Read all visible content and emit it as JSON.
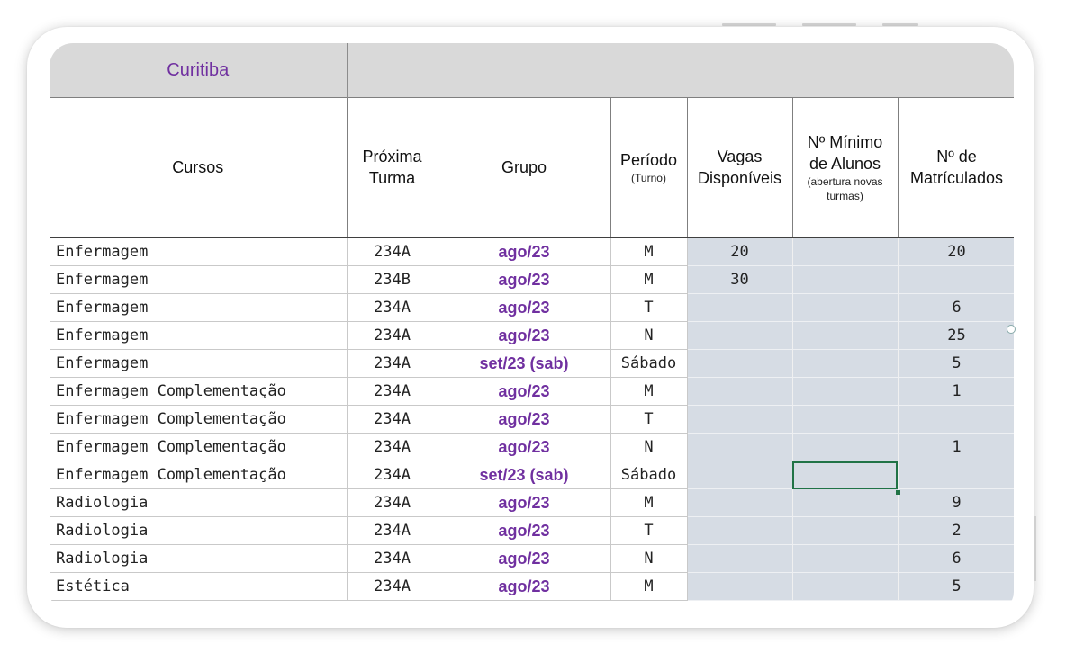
{
  "sheet": {
    "city": "Curitiba",
    "headers": {
      "cursos": "Cursos",
      "proxima_line1": "Próxima",
      "proxima_line2": "Turma",
      "grupo": "Grupo",
      "periodo": "Período",
      "periodo_sub": "(Turno)",
      "vagas_line1": "Vagas",
      "vagas_line2": "Disponíveis",
      "minimo_line1": "Nº Mínimo",
      "minimo_line2": "de Alunos",
      "minimo_sub": "(abertura novas turmas)",
      "matric_line1": "Nº de",
      "matric_line2": "Matrículados"
    },
    "rows": [
      {
        "curso": "Enfermagem",
        "turma": "234A",
        "grupo": "ago/23",
        "periodo": "M",
        "vagas": "20",
        "minimo": "",
        "matriculados": "20"
      },
      {
        "curso": "Enfermagem",
        "turma": "234B",
        "grupo": "ago/23",
        "periodo": "M",
        "vagas": "30",
        "minimo": "",
        "matriculados": ""
      },
      {
        "curso": "Enfermagem",
        "turma": "234A",
        "grupo": "ago/23",
        "periodo": "T",
        "vagas": "",
        "minimo": "",
        "matriculados": "6"
      },
      {
        "curso": "Enfermagem",
        "turma": "234A",
        "grupo": "ago/23",
        "periodo": "N",
        "vagas": "",
        "minimo": "",
        "matriculados": "25"
      },
      {
        "curso": "Enfermagem",
        "turma": "234A",
        "grupo": "set/23 (sab)",
        "periodo": "Sábado",
        "vagas": "",
        "minimo": "",
        "matriculados": "5"
      },
      {
        "curso": "Enfermagem Complementação",
        "turma": "234A",
        "grupo": "ago/23",
        "periodo": "M",
        "vagas": "",
        "minimo": "",
        "matriculados": "1"
      },
      {
        "curso": "Enfermagem Complementação",
        "turma": "234A",
        "grupo": "ago/23",
        "periodo": "T",
        "vagas": "",
        "minimo": "",
        "matriculados": ""
      },
      {
        "curso": "Enfermagem Complementação",
        "turma": "234A",
        "grupo": "ago/23",
        "periodo": "N",
        "vagas": "",
        "minimo": "",
        "matriculados": "1"
      },
      {
        "curso": "Enfermagem Complementação",
        "turma": "234A",
        "grupo": "set/23 (sab)",
        "periodo": "Sábado",
        "vagas": "",
        "minimo": "",
        "matriculados": ""
      },
      {
        "curso": "Radiologia",
        "turma": "234A",
        "grupo": "ago/23",
        "periodo": "M",
        "vagas": "",
        "minimo": "",
        "matriculados": "9"
      },
      {
        "curso": "Radiologia",
        "turma": "234A",
        "grupo": "ago/23",
        "periodo": "T",
        "vagas": "",
        "minimo": "",
        "matriculados": "2"
      },
      {
        "curso": "Radiologia",
        "turma": "234A",
        "grupo": "ago/23",
        "periodo": "N",
        "vagas": "",
        "minimo": "",
        "matriculados": "6"
      },
      {
        "curso": "Estética",
        "turma": "234A",
        "grupo": "ago/23",
        "periodo": "M",
        "vagas": "",
        "minimo": "",
        "matriculados": "5"
      }
    ],
    "selected_cell": {
      "row": 8,
      "column": "minimo"
    }
  }
}
